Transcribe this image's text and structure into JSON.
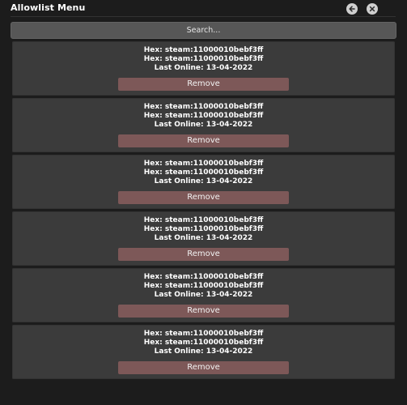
{
  "window": {
    "title": "Allowlist Menu"
  },
  "search": {
    "placeholder": "Search..."
  },
  "entries": [
    {
      "hex1": "Hex: steam:11000010bebf3ff",
      "hex2": "Hex: steam:11000010bebf3ff",
      "last_online": "Last Online: 13-04-2022",
      "remove_label": "Remove"
    },
    {
      "hex1": "Hex: steam:11000010bebf3ff",
      "hex2": "Hex: steam:11000010bebf3ff",
      "last_online": "Last Online: 13-04-2022",
      "remove_label": "Remove"
    },
    {
      "hex1": "Hex: steam:11000010bebf3ff",
      "hex2": "Hex: steam:11000010bebf3ff",
      "last_online": "Last Online: 13-04-2022",
      "remove_label": "Remove"
    },
    {
      "hex1": "Hex: steam:11000010bebf3ff",
      "hex2": "Hex: steam:11000010bebf3ff",
      "last_online": "Last Online: 13-04-2022",
      "remove_label": "Remove"
    },
    {
      "hex1": "Hex: steam:11000010bebf3ff",
      "hex2": "Hex: steam:11000010bebf3ff",
      "last_online": "Last Online: 13-04-2022",
      "remove_label": "Remove"
    },
    {
      "hex1": "Hex: steam:11000010bebf3ff",
      "hex2": "Hex: steam:11000010bebf3ff",
      "last_online": "Last Online: 13-04-2022",
      "remove_label": "Remove"
    }
  ],
  "icons": {
    "back": "arrow-left-icon",
    "close": "close-icon"
  },
  "colors": {
    "background": "#1c1c1c",
    "card": "#3b3b3b",
    "search": "#575757",
    "remove_button": "#7d5858"
  }
}
